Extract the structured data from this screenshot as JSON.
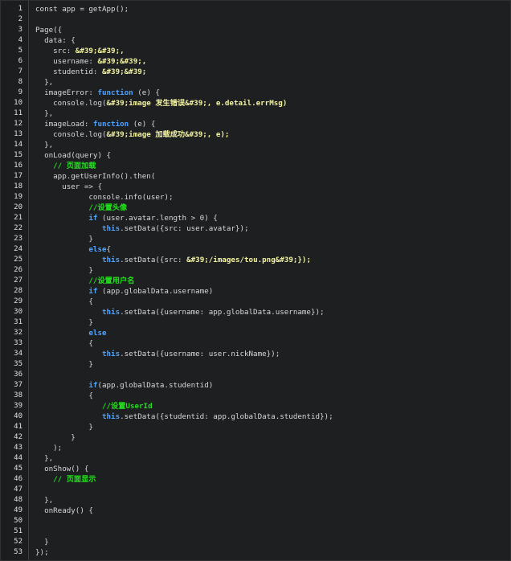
{
  "editor": {
    "lines": [
      {
        "n": "1",
        "tokens": [
          {
            "t": "pl",
            "v": "const app = getApp();"
          }
        ]
      },
      {
        "n": "2",
        "tokens": []
      },
      {
        "n": "3",
        "tokens": [
          {
            "t": "pl",
            "v": "Page({"
          }
        ]
      },
      {
        "n": "4",
        "tokens": [
          {
            "t": "pl",
            "v": "  data: {"
          }
        ]
      },
      {
        "n": "5",
        "tokens": [
          {
            "t": "pl",
            "v": "    src: "
          },
          {
            "t": "st",
            "v": "&#39;&#39;,"
          }
        ]
      },
      {
        "n": "6",
        "tokens": [
          {
            "t": "pl",
            "v": "    username: "
          },
          {
            "t": "st",
            "v": "&#39;&#39;,"
          }
        ]
      },
      {
        "n": "7",
        "tokens": [
          {
            "t": "pl",
            "v": "    studentid: "
          },
          {
            "t": "st",
            "v": "&#39;&#39;"
          }
        ]
      },
      {
        "n": "8",
        "tokens": [
          {
            "t": "pl",
            "v": "  },"
          }
        ]
      },
      {
        "n": "9",
        "tokens": [
          {
            "t": "pl",
            "v": "  imageError: "
          },
          {
            "t": "kw",
            "v": "function"
          },
          {
            "t": "pl",
            "v": " (e) {"
          }
        ]
      },
      {
        "n": "10",
        "tokens": [
          {
            "t": "pl",
            "v": "    console.log("
          },
          {
            "t": "st",
            "v": "&#39;image 发生错误&#39;, e.detail.errMsg)"
          }
        ]
      },
      {
        "n": "11",
        "tokens": [
          {
            "t": "pl",
            "v": "  },"
          }
        ]
      },
      {
        "n": "12",
        "tokens": [
          {
            "t": "pl",
            "v": "  imageLoad: "
          },
          {
            "t": "kw",
            "v": "function"
          },
          {
            "t": "pl",
            "v": " (e) {"
          }
        ]
      },
      {
        "n": "13",
        "tokens": [
          {
            "t": "pl",
            "v": "    console.log("
          },
          {
            "t": "st",
            "v": "&#39;image 加载成功&#39;, e);"
          }
        ]
      },
      {
        "n": "14",
        "tokens": [
          {
            "t": "pl",
            "v": "  },"
          }
        ]
      },
      {
        "n": "15",
        "tokens": [
          {
            "t": "pl",
            "v": "  onLoad(query) {"
          }
        ]
      },
      {
        "n": "16",
        "tokens": [
          {
            "t": "cm",
            "v": "    // 页面加载"
          }
        ]
      },
      {
        "n": "17",
        "tokens": [
          {
            "t": "pl",
            "v": "    app.getUserInfo().then("
          }
        ]
      },
      {
        "n": "18",
        "tokens": [
          {
            "t": "pl",
            "v": "      user => {"
          }
        ]
      },
      {
        "n": "19",
        "tokens": [
          {
            "t": "pl",
            "v": "            console.info(user);"
          }
        ]
      },
      {
        "n": "20",
        "tokens": [
          {
            "t": "cm",
            "v": "            //设置头像"
          }
        ]
      },
      {
        "n": "21",
        "tokens": [
          {
            "t": "kw",
            "v": "            if"
          },
          {
            "t": "pl",
            "v": " (user.avatar.length > 0) {"
          }
        ]
      },
      {
        "n": "22",
        "tokens": [
          {
            "t": "kw",
            "v": "               this"
          },
          {
            "t": "pl",
            "v": ".setData({src: user.avatar});"
          }
        ]
      },
      {
        "n": "23",
        "tokens": [
          {
            "t": "pl",
            "v": "            }"
          }
        ]
      },
      {
        "n": "24",
        "tokens": [
          {
            "t": "kw",
            "v": "            else"
          },
          {
            "t": "pl",
            "v": "{"
          }
        ]
      },
      {
        "n": "25",
        "tokens": [
          {
            "t": "kw",
            "v": "               this"
          },
          {
            "t": "pl",
            "v": ".setData({src: "
          },
          {
            "t": "st",
            "v": "&#39;/images/tou.png&#39;});"
          }
        ]
      },
      {
        "n": "26",
        "tokens": [
          {
            "t": "pl",
            "v": "            }"
          }
        ]
      },
      {
        "n": "27",
        "tokens": [
          {
            "t": "cm",
            "v": "            //设置用户名"
          }
        ]
      },
      {
        "n": "28",
        "tokens": [
          {
            "t": "kw",
            "v": "            if"
          },
          {
            "t": "pl",
            "v": " (app.globalData.username)"
          }
        ]
      },
      {
        "n": "29",
        "tokens": [
          {
            "t": "pl",
            "v": "            {"
          }
        ]
      },
      {
        "n": "30",
        "tokens": [
          {
            "t": "kw",
            "v": "               this"
          },
          {
            "t": "pl",
            "v": ".setData({username: app.globalData.username});"
          }
        ]
      },
      {
        "n": "31",
        "tokens": [
          {
            "t": "pl",
            "v": "            }"
          }
        ]
      },
      {
        "n": "32",
        "tokens": [
          {
            "t": "kw",
            "v": "            else"
          }
        ]
      },
      {
        "n": "33",
        "tokens": [
          {
            "t": "pl",
            "v": "            {"
          }
        ]
      },
      {
        "n": "34",
        "tokens": [
          {
            "t": "kw",
            "v": "               this"
          },
          {
            "t": "pl",
            "v": ".setData({username: user.nickName});"
          }
        ]
      },
      {
        "n": "35",
        "tokens": [
          {
            "t": "pl",
            "v": "            }"
          }
        ]
      },
      {
        "n": "36",
        "tokens": []
      },
      {
        "n": "37",
        "tokens": [
          {
            "t": "kw",
            "v": "            if"
          },
          {
            "t": "pl",
            "v": "(app.globalData.studentid)"
          }
        ]
      },
      {
        "n": "38",
        "tokens": [
          {
            "t": "pl",
            "v": "            {"
          }
        ]
      },
      {
        "n": "39",
        "tokens": [
          {
            "t": "cm",
            "v": "               //设置UserId"
          }
        ]
      },
      {
        "n": "40",
        "tokens": [
          {
            "t": "kw",
            "v": "               this"
          },
          {
            "t": "pl",
            "v": ".setData({studentid: app.globalData.studentid});"
          }
        ]
      },
      {
        "n": "41",
        "tokens": [
          {
            "t": "pl",
            "v": "            }"
          }
        ]
      },
      {
        "n": "42",
        "tokens": [
          {
            "t": "pl",
            "v": "        }"
          }
        ]
      },
      {
        "n": "43",
        "tokens": [
          {
            "t": "pl",
            "v": "    );"
          }
        ]
      },
      {
        "n": "44",
        "tokens": [
          {
            "t": "pl",
            "v": "  },"
          }
        ]
      },
      {
        "n": "45",
        "tokens": [
          {
            "t": "pl",
            "v": "  onShow() {"
          }
        ]
      },
      {
        "n": "46",
        "tokens": [
          {
            "t": "cm",
            "v": "    // 页面显示"
          }
        ]
      },
      {
        "n": "47",
        "tokens": []
      },
      {
        "n": "48",
        "tokens": [
          {
            "t": "pl",
            "v": "  },"
          }
        ]
      },
      {
        "n": "49",
        "tokens": [
          {
            "t": "pl",
            "v": "  onReady() {"
          }
        ]
      },
      {
        "n": "50",
        "tokens": []
      },
      {
        "n": "51",
        "tokens": []
      },
      {
        "n": "52",
        "tokens": [
          {
            "t": "pl",
            "v": "  }"
          }
        ]
      },
      {
        "n": "53",
        "tokens": [
          {
            "t": "pl",
            "v": "});"
          }
        ]
      }
    ]
  }
}
